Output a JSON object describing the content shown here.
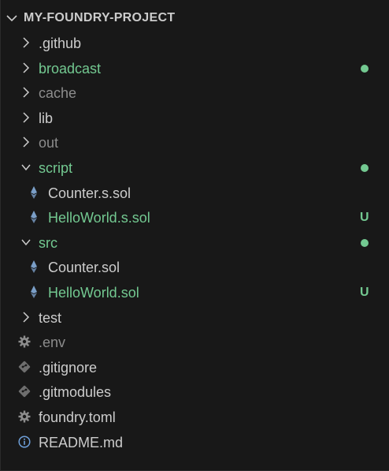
{
  "colors": {
    "default": "#cccccc",
    "ignored": "#8c8c8c",
    "untracked": "#73c991",
    "modified_dot": "#73c991",
    "solidity_icon": "#7a9ec7",
    "gear_icon": "#8c8c8c",
    "git_icon": "#6e6e6e",
    "info_icon": "#6e9fd8"
  },
  "explorer": {
    "title": "MY-FOUNDRY-PROJECT"
  },
  "tree": [
    {
      "label": ".github",
      "type": "folder",
      "expanded": false,
      "depth": 0,
      "status": "default",
      "decoration": ""
    },
    {
      "label": "broadcast",
      "type": "folder",
      "expanded": false,
      "depth": 0,
      "status": "untracked",
      "decoration": "dot"
    },
    {
      "label": "cache",
      "type": "folder",
      "expanded": false,
      "depth": 0,
      "status": "ignored",
      "decoration": ""
    },
    {
      "label": "lib",
      "type": "folder",
      "expanded": false,
      "depth": 0,
      "status": "default",
      "decoration": ""
    },
    {
      "label": "out",
      "type": "folder",
      "expanded": false,
      "depth": 0,
      "status": "ignored",
      "decoration": ""
    },
    {
      "label": "script",
      "type": "folder",
      "expanded": true,
      "depth": 0,
      "status": "untracked",
      "decoration": "dot"
    },
    {
      "label": "Counter.s.sol",
      "type": "file",
      "icon": "solidity-icon",
      "depth": 1,
      "status": "default",
      "decoration": ""
    },
    {
      "label": "HelloWorld.s.sol",
      "type": "file",
      "icon": "solidity-icon",
      "depth": 1,
      "status": "untracked",
      "decoration": "U"
    },
    {
      "label": "src",
      "type": "folder",
      "expanded": true,
      "depth": 0,
      "status": "untracked",
      "decoration": "dot"
    },
    {
      "label": "Counter.sol",
      "type": "file",
      "icon": "solidity-icon",
      "depth": 1,
      "status": "default",
      "decoration": ""
    },
    {
      "label": "HelloWorld.sol",
      "type": "file",
      "icon": "solidity-icon",
      "depth": 1,
      "status": "untracked",
      "decoration": "U"
    },
    {
      "label": "test",
      "type": "folder",
      "expanded": false,
      "depth": 0,
      "status": "default",
      "decoration": ""
    },
    {
      "label": ".env",
      "type": "file",
      "icon": "gear-icon",
      "depth": 0,
      "status": "ignored",
      "decoration": ""
    },
    {
      "label": ".gitignore",
      "type": "file",
      "icon": "git-icon",
      "depth": 0,
      "status": "default",
      "decoration": ""
    },
    {
      "label": ".gitmodules",
      "type": "file",
      "icon": "git-icon",
      "depth": 0,
      "status": "default",
      "decoration": ""
    },
    {
      "label": "foundry.toml",
      "type": "file",
      "icon": "gear-icon",
      "depth": 0,
      "status": "default",
      "decoration": ""
    },
    {
      "label": "README.md",
      "type": "file",
      "icon": "info-icon",
      "depth": 0,
      "status": "default",
      "decoration": ""
    }
  ]
}
